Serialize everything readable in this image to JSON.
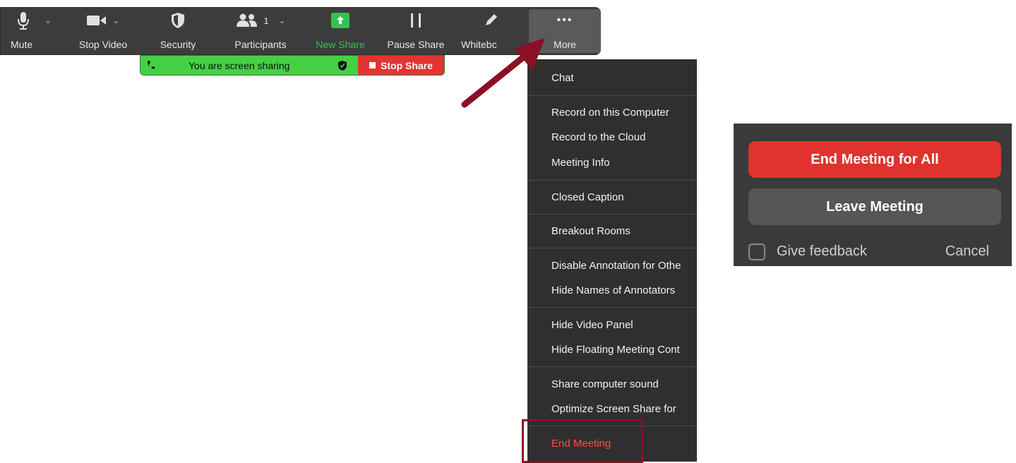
{
  "toolbar": {
    "mute": "Mute",
    "stop_video": "Stop Video",
    "security": "Security",
    "participants": "Participants",
    "participants_count": "1",
    "new_share": "New Share",
    "pause_share": "Pause Share",
    "whiteboard": "Whitebc",
    "more": "More",
    "more_glyph": "•••"
  },
  "share_bar": {
    "status": "You are screen sharing",
    "stop_label": "Stop Share",
    "green_color": "#43d143",
    "red_color": "#e33333"
  },
  "menu": {
    "items": [
      "Chat",
      "Record on this Computer",
      "Record to the Cloud",
      "Meeting Info",
      "Closed Caption",
      "Breakout Rooms",
      "Disable Annotation for Othe",
      "Hide Names of Annotators",
      "Hide Video Panel",
      "Hide Floating Meeting Cont",
      "Share computer sound",
      "Optimize Screen Share for",
      "End Meeting"
    ]
  },
  "dialog": {
    "end_all": "End Meeting for All",
    "leave": "Leave Meeting",
    "feedback": "Give feedback",
    "cancel": "Cancel",
    "accent": "#e0332e"
  },
  "icons": [
    "microphone-icon",
    "video-camera-icon",
    "shield-icon",
    "participants-icon",
    "share-arrow-icon",
    "pause-icon",
    "pencil-icon",
    "more-dots-icon",
    "end-call-icon",
    "shield-check-icon",
    "stop-square-icon",
    "arrow-pointer-icon"
  ]
}
